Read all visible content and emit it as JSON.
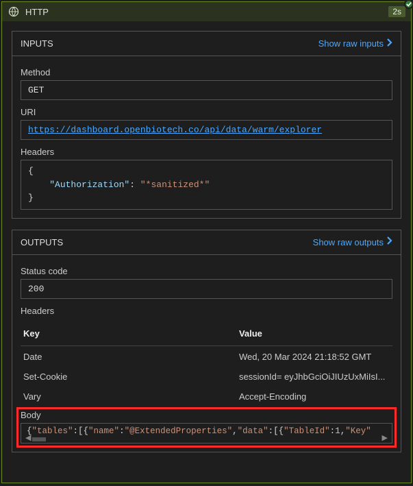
{
  "title": "HTTP",
  "duration": "2s",
  "inputs": {
    "panel_title": "INPUTS",
    "raw_link": "Show raw inputs",
    "method_label": "Method",
    "method_value": "GET",
    "uri_label": "URI",
    "uri_value": "https://dashboard.openbiotech.co/api/data/warm/explorer",
    "headers_label": "Headers",
    "headers_json": {
      "brace_open": "{",
      "line_indent": "    ",
      "key": "\"Authorization\"",
      "colon": ": ",
      "value": "\"*sanitized*\"",
      "brace_close": "}"
    }
  },
  "outputs": {
    "panel_title": "OUTPUTS",
    "raw_link": "Show raw outputs",
    "status_label": "Status code",
    "status_value": "200",
    "headers_label": "Headers",
    "table": {
      "col_key": "Key",
      "col_value": "Value",
      "rows": [
        {
          "k": "Date",
          "v": "Wed, 20 Mar 2024 21:18:52 GMT"
        },
        {
          "k": "Set-Cookie",
          "v": "sessionId= eyJhbGciOiJIUzUxMiIsI..."
        },
        {
          "k": "Vary",
          "v": "Accept-Encoding"
        }
      ]
    },
    "body_label": "Body",
    "body_code": "{\"tables\":[{\"name\":\"@ExtendedProperties\",\"data\":[{\"TableId\":1,\"Key\""
  }
}
